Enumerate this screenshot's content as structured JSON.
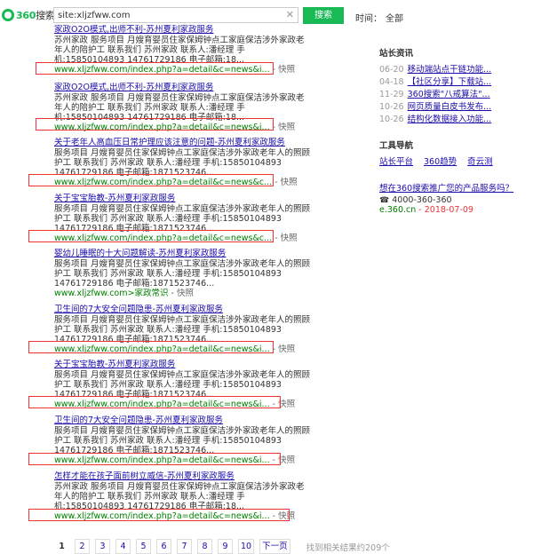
{
  "header": {
    "logo_brand": "360",
    "logo_suffix": "搜索",
    "search_value": "site:xljzfww.com",
    "clear_glyph": "✕",
    "search_button": "搜索",
    "time_label": "时间：",
    "time_value": "全部"
  },
  "results": [
    {
      "title": "家政O2O模式,出师不利-苏州夏利家政服务",
      "snippet": "苏州家政 服务项目 月嫂育婴员住家保姆钟点工家庭保洁涉外家政老年人的陪护工 联系我们 苏州家政 联系人:潘经理 手机:15850104893 14761729186 电子邮箱:18...",
      "url": "www.xljzfww.com/index.php?a=detail&c=news&i...",
      "snap": "- 快照"
    },
    {
      "title": "家政O2O模式,出师不利-苏州夏利家政服务",
      "snippet": "苏州家政 服务项目 月嫂育婴员住家保姆钟点工家庭保洁涉外家政老年人的陪护工 联系我们 苏州家政 联系人:潘经理 手机:15850104893 14761729186 电子邮箱:18...",
      "url": "www.xljzfww.com/index.php?a=detail&c=news&i...",
      "snap": "- 快照"
    },
    {
      "title": "关于老年人高血压日常护理应该注意的问题-苏州夏利家政服务",
      "snippet": "服务项目 月嫂育婴员住家保姆钟点工家庭保洁涉外家政老年人的照顾护工 联系我们 苏州家政 联系人:潘经理 手机:15850104893 14761729186 电子邮箱:1871523746...",
      "url": "www.xljzfww.com/index.php?a=detail&c=news&c...",
      "snap": "- 快照"
    },
    {
      "title": "关于宝宝胎教-苏州夏利家政服务",
      "snippet": "服务项目 月嫂育婴员住家保姆钟点工家庭保洁涉外家政老年人的照顾护工 联系我们 苏州家政 联系人:潘经理 手机:15850104893 14761729186 电子邮箱:1871523746...",
      "url": "www.xljzfww.com/index.php?a=detail&c=news&c...",
      "snap": "- 快照"
    },
    {
      "title": "婴幼儿睡眠的十大问题解读-苏州夏利家政服务",
      "snippet": "服务项目 月嫂育婴员住家保姆钟点工家庭保洁涉外家政老年人的照顾护工 联系我们 苏州家政 联系人:潘经理 手机:15850104893 14761729186 电子邮箱:1871523746...",
      "url": "www.xljzfww.com>家政常识",
      "snap": "- 快照"
    },
    {
      "title": "卫生间的7大安全问题隐患-苏州夏利家政服务",
      "snippet": "服务项目 月嫂育婴员住家保姆钟点工家庭保洁涉外家政老年人的照顾护工 联系我们 苏州家政 联系人:潘经理 手机:15850104893 14761729186 电子邮箱:1871523746...",
      "url": "www.xljzfww.com/index.php?a=detail&c=news&i...",
      "snap": "- 快照"
    },
    {
      "title": "关于宝宝胎教-苏州夏利家政服务",
      "snippet": "服务项目 月嫂育婴员住家保姆钟点工家庭保洁涉外家政老年人的照顾护工 联系我们 苏州家政 联系人:潘经理 手机:15850104893 14761729186 电子邮箱:1871523746...",
      "url": "www.xljzfww.com/index.php?a=detail&c=news&i...",
      "snap": "- 快照"
    },
    {
      "title": "卫生间的7大安全问题隐患-苏州夏利家政服务",
      "snippet": "服务项目 月嫂育婴员住家保姆钟点工家庭保洁涉外家政老年人的照顾护工 联系我们 苏州家政 联系人:潘经理 手机:15850104893 14761729186 电子邮箱:1871523746...",
      "url": "www.xljzfww.com/index.php?a=detail&c=news&i...",
      "snap": "- 快照"
    },
    {
      "title": "怎样才能在孩子面前树立威信-苏州夏利家政服务",
      "snippet": "苏州家政 服务项目 月嫂育婴员住家保姆钟点工家庭保洁涉外家政老年人的陪护工 联系我们 苏州家政 联系人:潘经理 手机:15850104893 14761729186 电子邮箱:18...",
      "url": "www.xljzfww.com/index.php?a=detail&c=news&i...",
      "snap": "- 快照"
    }
  ],
  "sidebar": {
    "news_title": "站长资讯",
    "news": [
      {
        "date": "06-20",
        "text": "移动端站点干链功能..."
      },
      {
        "date": "04-18",
        "text": "【社区分享】下载站..."
      },
      {
        "date": "11-29",
        "text": "360搜索\"八戒算法\"..."
      },
      {
        "date": "10-26",
        "text": "网页质量白皮书发布..."
      },
      {
        "date": "10-26",
        "text": "结构化数据接入功能..."
      }
    ],
    "tools_title": "工具导航",
    "tools": [
      "站长平台",
      "360趋势",
      "奇云测"
    ],
    "promo": "想在360搜索推广您的产品服务吗？",
    "phone_icon": "☎",
    "phone": "4000-360-360",
    "site": "e.360.cn",
    "site_date": "- 2018-07-09"
  },
  "pager": {
    "pages": [
      "1",
      "2",
      "3",
      "4",
      "5",
      "6",
      "7",
      "8",
      "9",
      "10"
    ],
    "current": "1",
    "next": "下一页",
    "found": "找到相关结果约209个"
  }
}
